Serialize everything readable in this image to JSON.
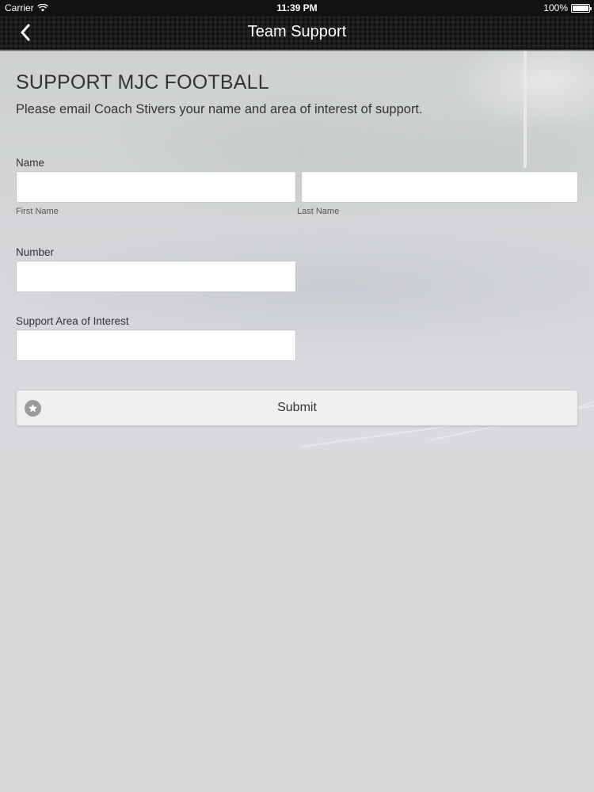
{
  "status_bar": {
    "carrier": "Carrier",
    "time": "11:39 PM",
    "battery": "100%"
  },
  "nav": {
    "title": "Team Support",
    "back_icon": "chevron-left-icon"
  },
  "form": {
    "heading": "SUPPORT MJC FOOTBALL",
    "description": "Please email Coach Stivers your name and area of interest of support.",
    "name_label": "Name",
    "first_name_sublabel": "First Name",
    "last_name_sublabel": "Last Name",
    "first_name_value": "",
    "last_name_value": "",
    "number_label": "Number",
    "number_value": "",
    "interest_label": "Support Area of Interest",
    "interest_value": "",
    "submit_label": "Submit",
    "submit_icon": "star-icon"
  },
  "colors": {
    "nav_background": "#1a1a1a",
    "page_background": "#d9d8d8",
    "text": "#333333"
  }
}
